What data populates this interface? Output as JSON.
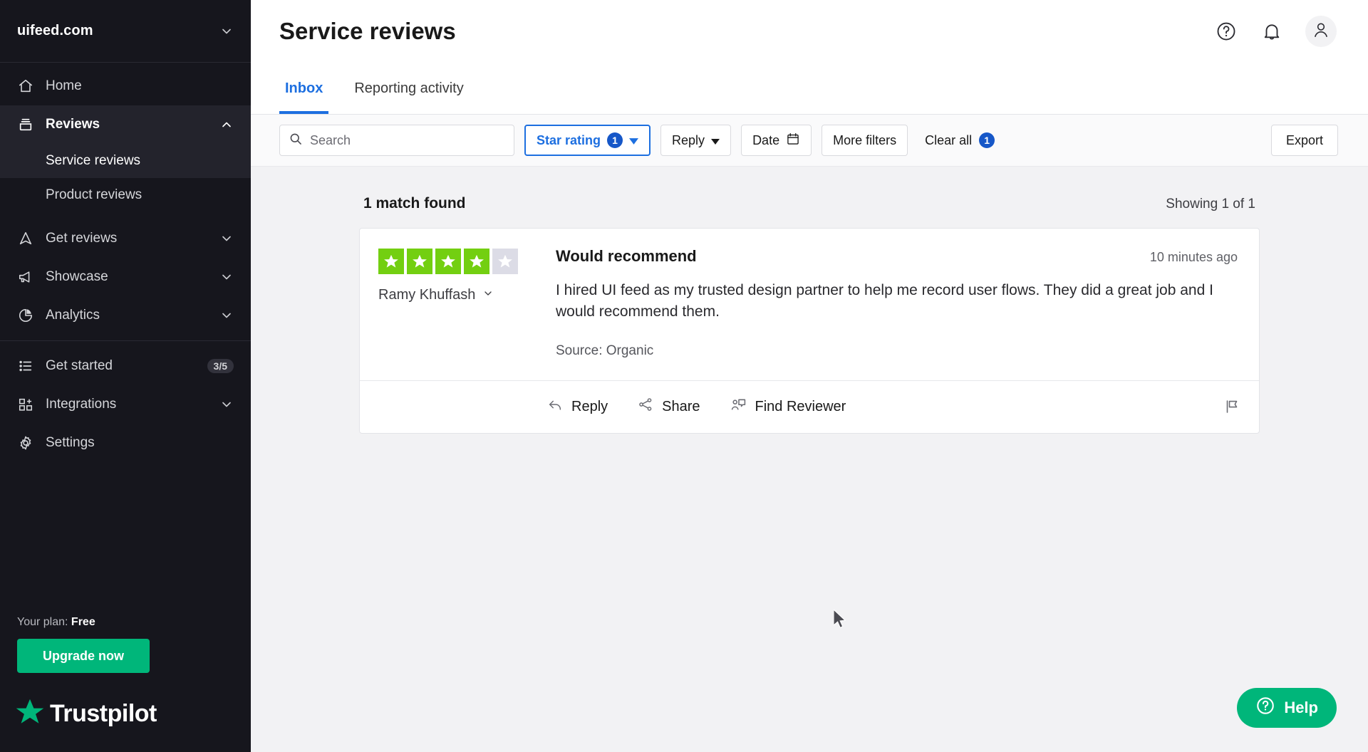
{
  "sidebar": {
    "brand": "uifeed.com",
    "brand_chevron_icon": "chevron-down-icon",
    "items": [
      {
        "label": "Home",
        "icon": "home-icon"
      },
      {
        "label": "Reviews",
        "icon": "inbox-icon"
      },
      {
        "label": "Service reviews",
        "icon": ""
      },
      {
        "label": "Product reviews",
        "icon": ""
      },
      {
        "label": "Get reviews",
        "icon": "send-icon"
      },
      {
        "label": "Showcase",
        "icon": "megaphone-icon"
      },
      {
        "label": "Analytics",
        "icon": "pie-chart-icon"
      },
      {
        "label": "Get started",
        "icon": "checklist-icon",
        "badge": "3/5"
      },
      {
        "label": "Integrations",
        "icon": "grid-plus-icon"
      },
      {
        "label": "Settings",
        "icon": "gear-icon"
      }
    ],
    "plan_label": "Your plan:",
    "plan_value": "Free",
    "upgrade_label": "Upgrade now",
    "logo_word": "Trustpilot"
  },
  "header": {
    "title": "Service reviews",
    "help_icon": "question-circle-icon",
    "bell_icon": "bell-icon",
    "avatar_icon": "user-avatar-icon"
  },
  "tabs": [
    {
      "label": "Inbox",
      "active": true
    },
    {
      "label": "Reporting activity",
      "active": false
    }
  ],
  "filters": {
    "search_placeholder": "Search",
    "search_value": "",
    "search_icon": "search-icon",
    "star_rating": {
      "label": "Star rating",
      "count": "1",
      "chevron_icon": "caret-down-icon"
    },
    "reply": {
      "label": "Reply",
      "chevron_icon": "caret-down-icon"
    },
    "date": {
      "label": "Date",
      "icon": "calendar-icon"
    },
    "more_filters": {
      "label": "More filters"
    },
    "clear_all": {
      "label": "Clear all",
      "count": "1"
    },
    "export": {
      "label": "Export"
    }
  },
  "results": {
    "match_count": "1 match found",
    "showing": "Showing 1 of 1"
  },
  "review": {
    "rating": 4,
    "rating_max": 5,
    "reviewer_name": "Ramy Khuffash",
    "reviewer_chevron_icon": "chevron-down-icon",
    "title": "Would recommend",
    "time": "10 minutes ago",
    "body": "I hired UI feed as my trusted design partner to help me record user flows. They did a great job and I would recommend them.",
    "source": "Source: Organic",
    "actions": [
      {
        "label": "Reply",
        "icon": "reply-arrow-icon"
      },
      {
        "label": "Share",
        "icon": "share-nodes-icon"
      },
      {
        "label": "Find Reviewer",
        "icon": "find-reviewer-icon"
      }
    ],
    "flag_icon": "flag-icon"
  },
  "help_fab": {
    "label": "Help",
    "icon": "question-circle-icon"
  },
  "colors": {
    "sidebar_bg": "#16161d",
    "accent_blue": "#1d6fe0",
    "badge_blue": "#1657c8",
    "brand_green": "#00b67a",
    "star_green": "#73cf11",
    "star_off": "#dcdce6",
    "content_bg": "#f2f2f4"
  }
}
